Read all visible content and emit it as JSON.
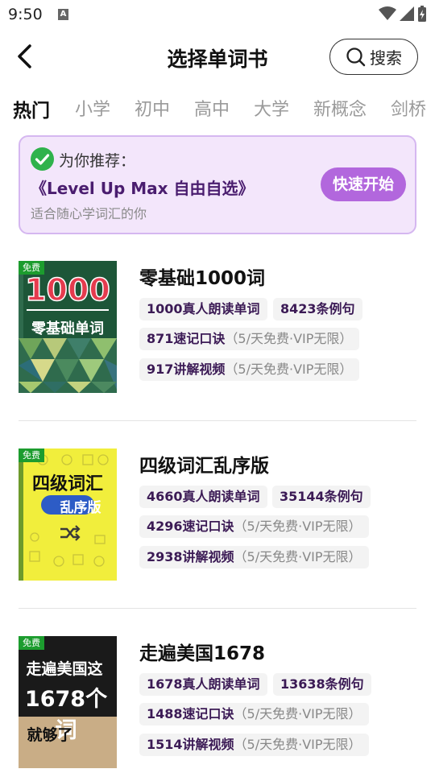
{
  "status": {
    "time": "9:50",
    "notification_icon": "A"
  },
  "header": {
    "title": "选择单词书",
    "search_label": "搜索"
  },
  "tabs": [
    {
      "label": "热门",
      "active": true
    },
    {
      "label": "小学",
      "active": false
    },
    {
      "label": "初中",
      "active": false
    },
    {
      "label": "高中",
      "active": false
    },
    {
      "label": "大学",
      "active": false
    },
    {
      "label": "新概念",
      "active": false
    },
    {
      "label": "剑桥",
      "active": false
    }
  ],
  "recommend": {
    "heading": "为你推荐：",
    "book_name": "《Level Up Max 自由自选》",
    "description": "适合随心学词汇的你",
    "start_button": "快速开始"
  },
  "books": [
    {
      "title": "零基础1000词",
      "free_tag": "免费",
      "cover": {
        "line1": "1000",
        "line2": "零基础单词"
      },
      "audio": "1000真人朗读单词",
      "examples": "8423条例句",
      "mnemonics": "871速记口诀",
      "mnemonics_note": "（5/天免费·VIP无限）",
      "videos": "917讲解视频",
      "videos_note": "（5/天免费·VIP无限）"
    },
    {
      "title": "四级词汇乱序版",
      "free_tag": "免费",
      "cover": {
        "line1": "四级词汇",
        "line2": "乱序版"
      },
      "audio": "4660真人朗读单词",
      "examples": "35144条例句",
      "mnemonics": "4296速记口诀",
      "mnemonics_note": "（5/天免费·VIP无限）",
      "videos": "2938讲解视频",
      "videos_note": "（5/天免费·VIP无限）"
    },
    {
      "title": "走遍美国1678",
      "free_tag": "免费",
      "cover": {
        "line1": "走遍美国这",
        "line2": "1678个词",
        "line3": "就够了"
      },
      "audio": "1678真人朗读单词",
      "examples": "13638条例句",
      "mnemonics": "1488速记口诀",
      "mnemonics_note": "（5/天免费·VIP无限）",
      "videos": "1514讲解视频",
      "videos_note": "（5/天免费·VIP无限）"
    }
  ],
  "colors": {
    "accent_purple": "#b267dd",
    "chip_text": "#3b1a55",
    "free_green": "#1c9c2e"
  }
}
